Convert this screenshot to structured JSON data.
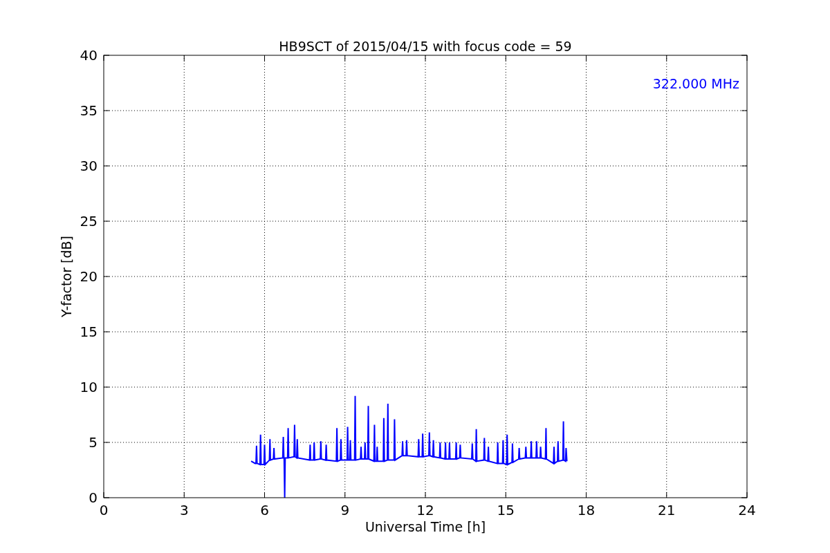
{
  "figure": {
    "chart_data": {
      "type": "line",
      "title": "HB9SCT of 2015/04/15 with focus code = 59",
      "xlabel": "Universal Time [h]",
      "ylabel": "Y-factor [dB]",
      "xlim": [
        0,
        24
      ],
      "ylim": [
        0,
        40
      ],
      "xticks": [
        0,
        3,
        6,
        9,
        12,
        15,
        18,
        21,
        24
      ],
      "yticks": [
        0,
        5,
        10,
        15,
        20,
        25,
        30,
        35,
        40
      ],
      "x": [
        5.5,
        5.65,
        5.68,
        5.7,
        5.72,
        5.83,
        5.85,
        5.87,
        5.98,
        6.0,
        6.02,
        6.18,
        6.2,
        6.22,
        6.33,
        6.35,
        6.37,
        6.68,
        6.7,
        6.72,
        6.73,
        6.75,
        6.77,
        6.86,
        6.88,
        6.9,
        7.1,
        7.12,
        7.14,
        7.2,
        7.22,
        7.24,
        7.68,
        7.7,
        7.72,
        7.83,
        7.85,
        7.87,
        8.08,
        8.1,
        8.12,
        8.28,
        8.3,
        8.32,
        8.68,
        8.7,
        8.72,
        8.83,
        8.85,
        8.87,
        9.08,
        9.1,
        9.12,
        9.18,
        9.2,
        9.22,
        9.36,
        9.38,
        9.4,
        9.58,
        9.6,
        9.62,
        9.73,
        9.75,
        9.77,
        9.85,
        9.87,
        9.89,
        10.08,
        10.1,
        10.12,
        10.18,
        10.2,
        10.22,
        10.43,
        10.45,
        10.47,
        10.58,
        10.6,
        10.62,
        10.83,
        10.85,
        10.87,
        11.13,
        11.15,
        11.17,
        11.28,
        11.3,
        11.32,
        11.73,
        11.75,
        11.77,
        11.88,
        11.9,
        11.92,
        12.13,
        12.15,
        12.17,
        12.28,
        12.3,
        12.32,
        12.53,
        12.55,
        12.57,
        12.73,
        12.75,
        12.77,
        12.88,
        12.9,
        12.92,
        13.13,
        13.15,
        13.17,
        13.28,
        13.3,
        13.32,
        13.73,
        13.75,
        13.77,
        13.88,
        13.9,
        13.92,
        14.18,
        14.2,
        14.22,
        14.33,
        14.35,
        14.37,
        14.68,
        14.7,
        14.72,
        14.88,
        14.9,
        14.92,
        15.03,
        15.05,
        15.07,
        15.23,
        15.25,
        15.27,
        15.48,
        15.5,
        15.52,
        15.73,
        15.75,
        15.77,
        15.93,
        15.95,
        15.97,
        16.13,
        16.15,
        16.17,
        16.28,
        16.3,
        16.32,
        16.48,
        16.5,
        16.52,
        16.78,
        16.8,
        16.82,
        16.93,
        16.95,
        16.97,
        17.13,
        17.15,
        17.17,
        17.23,
        17.25,
        17.28
      ],
      "series": [
        {
          "name": "322.000 MHz",
          "color": "#0000ff",
          "values": [
            3.3,
            3.1,
            3.1,
            4.7,
            3.1,
            3.0,
            5.7,
            3.0,
            3.0,
            4.8,
            3.0,
            3.4,
            5.3,
            3.4,
            3.5,
            4.5,
            3.5,
            3.6,
            5.5,
            3.6,
            3.6,
            0,
            3.6,
            3.6,
            6.3,
            3.6,
            3.7,
            6.6,
            3.7,
            3.6,
            5.3,
            3.6,
            3.4,
            4.8,
            3.4,
            3.4,
            5.0,
            3.4,
            3.5,
            5.1,
            3.5,
            3.4,
            4.8,
            3.4,
            3.3,
            6.3,
            3.3,
            3.4,
            5.3,
            3.4,
            3.4,
            6.4,
            3.4,
            3.4,
            5.2,
            3.4,
            3.4,
            9.2,
            3.4,
            3.5,
            4.6,
            3.5,
            3.5,
            5.0,
            3.5,
            3.5,
            8.3,
            3.5,
            3.3,
            6.6,
            3.3,
            3.3,
            4.6,
            3.3,
            3.3,
            7.2,
            3.3,
            3.4,
            8.5,
            3.4,
            3.4,
            7.1,
            3.4,
            3.8,
            5.1,
            3.8,
            3.8,
            5.2,
            3.8,
            3.7,
            5.3,
            3.7,
            3.7,
            5.8,
            3.7,
            3.8,
            5.9,
            3.8,
            3.7,
            5.2,
            3.7,
            3.6,
            5.0,
            3.6,
            3.5,
            5.0,
            3.5,
            3.5,
            5.0,
            3.5,
            3.5,
            5.0,
            3.5,
            3.6,
            4.8,
            3.6,
            3.5,
            4.9,
            3.5,
            3.3,
            6.2,
            3.3,
            3.4,
            5.4,
            3.4,
            3.3,
            4.6,
            3.3,
            3.1,
            5.0,
            3.1,
            3.1,
            5.2,
            3.1,
            3.0,
            5.7,
            3.0,
            3.2,
            4.9,
            3.2,
            3.5,
            4.5,
            3.5,
            3.6,
            4.6,
            3.6,
            3.6,
            5.1,
            3.6,
            3.6,
            5.1,
            3.6,
            3.6,
            4.6,
            3.6,
            3.5,
            6.3,
            3.5,
            3.1,
            4.6,
            3.1,
            3.3,
            5.1,
            3.3,
            3.4,
            6.9,
            3.4,
            3.3,
            4.5,
            3.3
          ]
        }
      ],
      "grid": true
    }
  }
}
